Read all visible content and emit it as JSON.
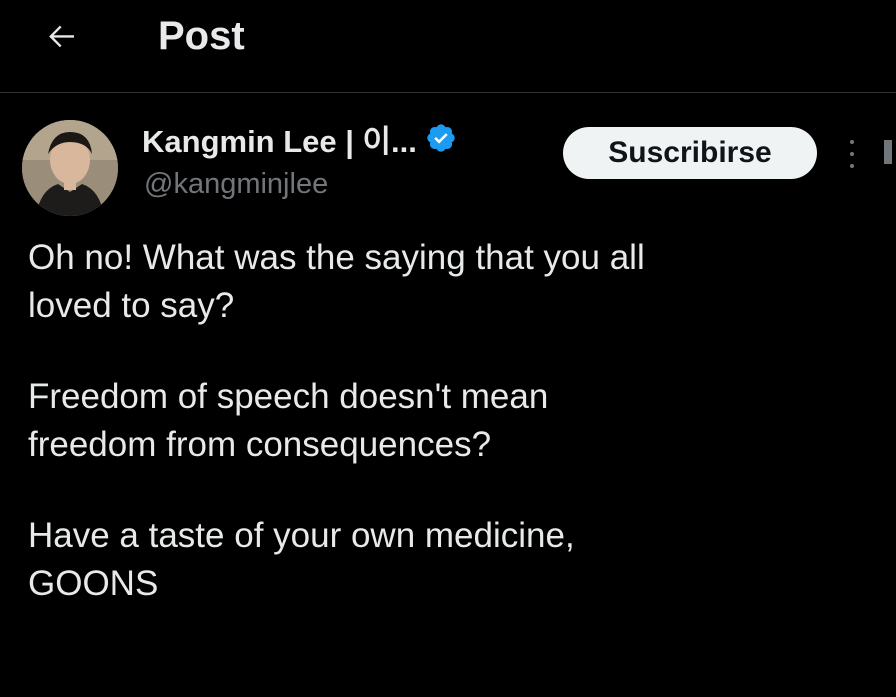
{
  "header": {
    "title": "Post",
    "back_icon": "arrow-left-icon"
  },
  "author": {
    "name": "Kangmin Lee | 이...",
    "handle": "@kangminjlee",
    "verified_icon": "verified-badge-icon",
    "verified_color": "#1d9bf0"
  },
  "actions": {
    "subscribe_label": "Suscribirse",
    "more_icon": "more-vertical-icon"
  },
  "post": {
    "paragraphs": [
      "Oh no! What was the saying that you all\nloved to say?",
      "Freedom of speech doesn't mean\nfreedom from consequences?",
      "Have a taste of your own medicine,\nGOONS"
    ]
  },
  "colors": {
    "background": "#000000",
    "text_primary": "#e7e9ea",
    "text_secondary": "#71767b",
    "button_bg": "#eff3f4",
    "button_text": "#0f1419",
    "divider": "#2f3336"
  }
}
